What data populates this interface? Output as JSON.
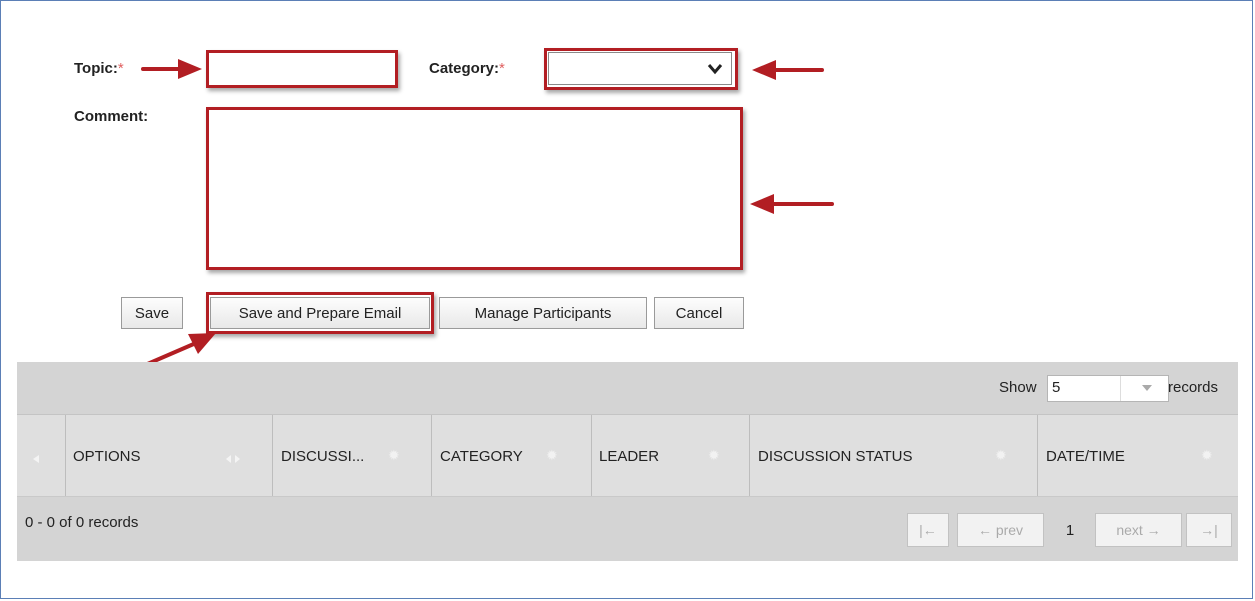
{
  "form": {
    "topic_label": "Topic:",
    "topic_required": "*",
    "topic_value": "",
    "category_label": "Category:",
    "category_required": "*",
    "category_selected": "",
    "comment_label": "Comment:",
    "comment_value": ""
  },
  "buttons": {
    "save": "Save",
    "save_email": "Save and Prepare Email",
    "manage": "Manage Participants",
    "cancel": "Cancel"
  },
  "grid": {
    "show_label": "Show",
    "page_size": "5",
    "records_label": "records",
    "columns": [
      "OPTIONS",
      "DISCUSSI...",
      "CATEGORY",
      "LEADER",
      "DISCUSSION STATUS",
      "DATE/TIME"
    ],
    "record_summary": "0 - 0 of 0 records",
    "pager": {
      "first": "|←",
      "prev": "← prev",
      "current": "1",
      "next": "next →",
      "last": "→|"
    }
  },
  "colors": {
    "highlight": "#b21e23",
    "required": "#e06060",
    "grid_bar": "#d4d4d4"
  },
  "icons": [
    "arrow-annotation",
    "chevron-down-icon",
    "sort-icon",
    "gear-icon",
    "dropdown-triangle-icon"
  ]
}
